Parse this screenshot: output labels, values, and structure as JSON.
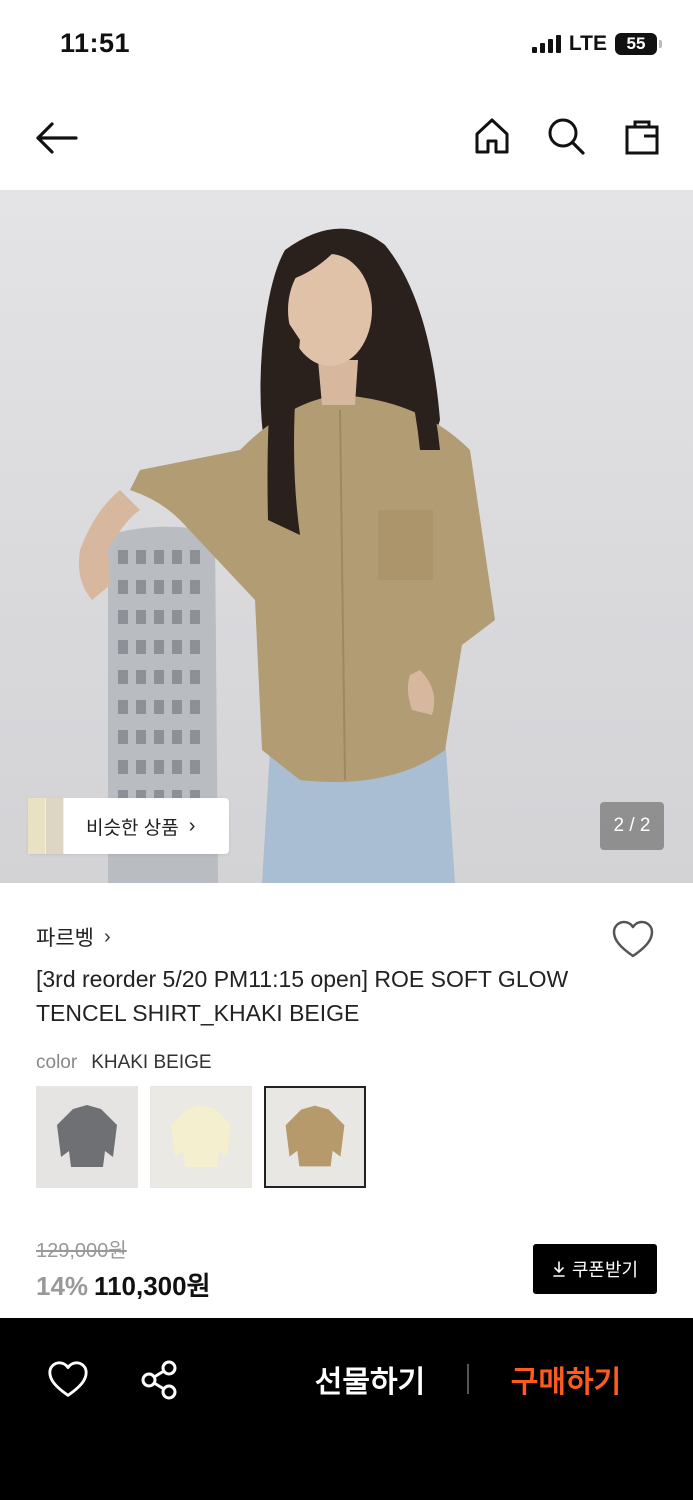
{
  "status": {
    "time": "11:51",
    "network": "LTE",
    "battery": "55"
  },
  "nav": {
    "back_icon": "arrow-left-icon",
    "home_icon": "home-icon",
    "search_icon": "search-icon",
    "bag_icon": "shopping-bag-icon"
  },
  "hero": {
    "similar_label": "비슷한 상품",
    "page_counter": "2 / 2"
  },
  "product": {
    "brand": "파르벵",
    "title": "[3rd reorder 5/20 PM11:15 open] ROE SOFT GLOW TENCEL SHIRT_KHAKI BEIGE",
    "color_label": "color",
    "color_value": "KHAKI BEIGE",
    "swatches": [
      {
        "name": "charcoal",
        "color": "#6f7073",
        "bg": "#e6e4e2"
      },
      {
        "name": "cream",
        "color": "#f3efcf",
        "bg": "#ebe9e4"
      },
      {
        "name": "khaki-beige",
        "color": "#b79a6c",
        "bg": "#e9e7e3",
        "selected": true
      }
    ],
    "original_price": "129,000원",
    "discount": "14%",
    "price": "110,300원",
    "coupon_label": "쿠폰받기"
  },
  "bottom": {
    "gift_label": "선물하기",
    "buy_label": "구매하기",
    "buy_color": "#ff5a1f"
  }
}
